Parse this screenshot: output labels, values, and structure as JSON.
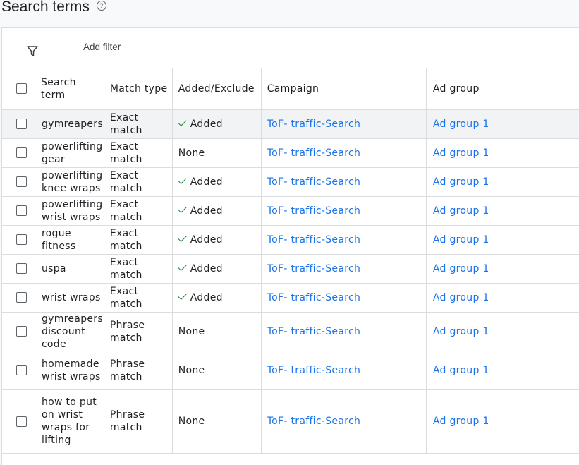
{
  "header": {
    "title": "Search terms",
    "help_glyph": "?"
  },
  "toolbar": {
    "add_filter_label": "Add filter"
  },
  "columns": [
    "Search term",
    "Match type",
    "Added/Exclude",
    "Campaign",
    "Ad group"
  ],
  "rows": [
    {
      "term": "gymreapers",
      "match": "Exact match",
      "added": "Added",
      "added_check": true,
      "campaign": "ToF- traffic-Search",
      "ad_group": "Ad group 1"
    },
    {
      "term": "powerlifting gear",
      "match": "Exact match",
      "added": "None",
      "added_check": false,
      "campaign": "ToF- traffic-Search",
      "ad_group": "Ad group 1"
    },
    {
      "term": "powerlifting knee wraps",
      "match": "Exact match",
      "added": "Added",
      "added_check": true,
      "campaign": "ToF- traffic-Search",
      "ad_group": "Ad group 1"
    },
    {
      "term": "powerlifting wrist wraps",
      "match": "Exact match",
      "added": "Added",
      "added_check": true,
      "campaign": "ToF- traffic-Search",
      "ad_group": "Ad group 1"
    },
    {
      "term": "rogue fitness",
      "match": "Exact match",
      "added": "Added",
      "added_check": true,
      "campaign": "ToF- traffic-Search",
      "ad_group": "Ad group 1"
    },
    {
      "term": "uspa",
      "match": "Exact match",
      "added": "Added",
      "added_check": true,
      "campaign": "ToF- traffic-Search",
      "ad_group": "Ad group 1"
    },
    {
      "term": "wrist wraps",
      "match": "Exact match",
      "added": "Added",
      "added_check": true,
      "campaign": "ToF- traffic-Search",
      "ad_group": "Ad group 1"
    },
    {
      "term": "gymreapers discount code",
      "match": "Phrase match",
      "added": "None",
      "added_check": false,
      "campaign": "ToF- traffic-Search",
      "ad_group": "Ad group 1"
    },
    {
      "term": "homemade wrist wraps",
      "match": "Phrase match",
      "added": "None",
      "added_check": false,
      "campaign": "ToF- traffic-Search",
      "ad_group": "Ad group 1"
    },
    {
      "term": "how to put on wrist wraps for lifting",
      "match": "Phrase match",
      "added": "None",
      "added_check": false,
      "campaign": "ToF- traffic-Search",
      "ad_group": "Ad group 1"
    }
  ]
}
